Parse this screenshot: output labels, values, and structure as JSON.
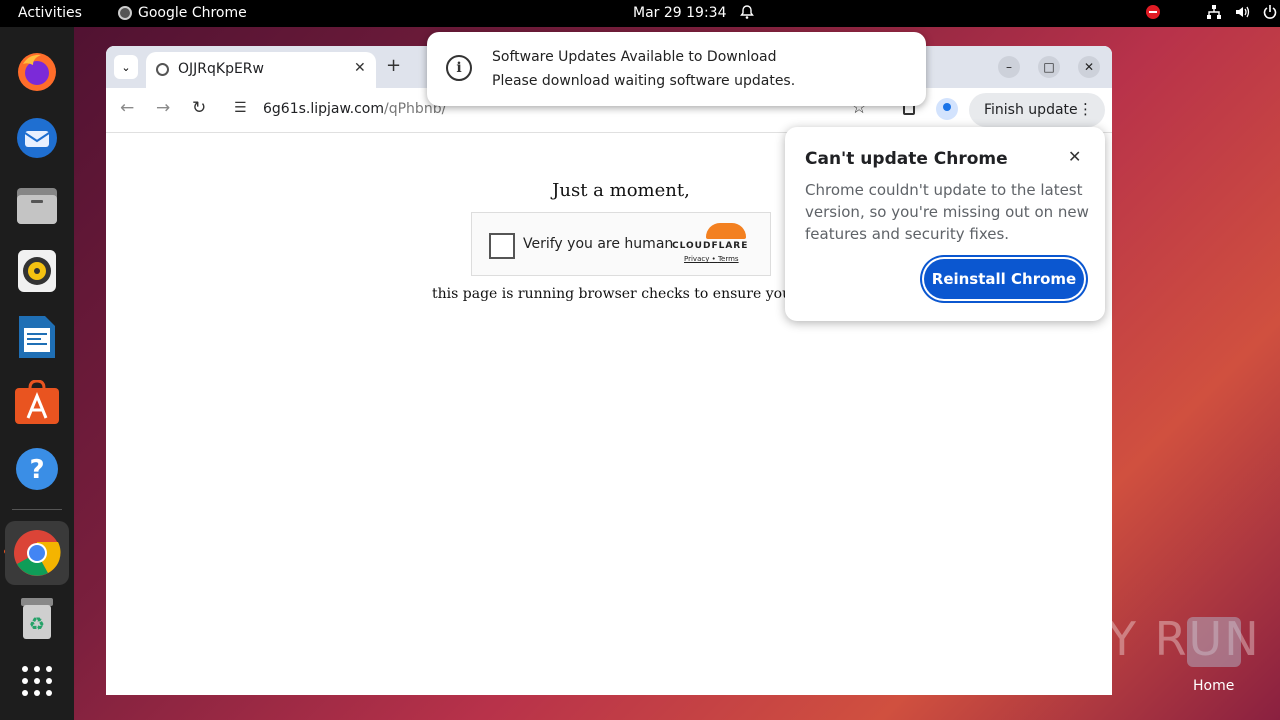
{
  "topbar": {
    "activities": "Activities",
    "app_name": "Google Chrome",
    "clock": "Mar 29  19:34"
  },
  "dock": {
    "items": [
      "firefox-icon",
      "thunderbird-icon",
      "files-icon",
      "rhythmbox-icon",
      "writer-icon",
      "app-center-icon",
      "help-icon",
      "chrome-icon",
      "trash-icon",
      "show-apps-icon"
    ]
  },
  "browser": {
    "tab_title": "OJJRqKpERw",
    "url_host": "6g61s.lipjaw.com",
    "url_path": "/qPhbnb/",
    "finish_update": "Finish update"
  },
  "page": {
    "heading": "Just a moment,",
    "verify_label": "Verify you are human",
    "cloudflare": "CLOUDFLARE",
    "privacy": "Privacy",
    "terms": "Terms",
    "subtext": "this page is running browser checks to ensure your secu"
  },
  "notification": {
    "title": "Software Updates Available to Download",
    "body": "Please download waiting software updates."
  },
  "popup": {
    "title": "Can't update Chrome",
    "body": "Chrome couldn't update to the latest version, so you're missing out on new features and security fixes.",
    "button": "Reinstall Chrome"
  },
  "desktop": {
    "watermark": "ANY RUN",
    "home_label": "Home"
  }
}
